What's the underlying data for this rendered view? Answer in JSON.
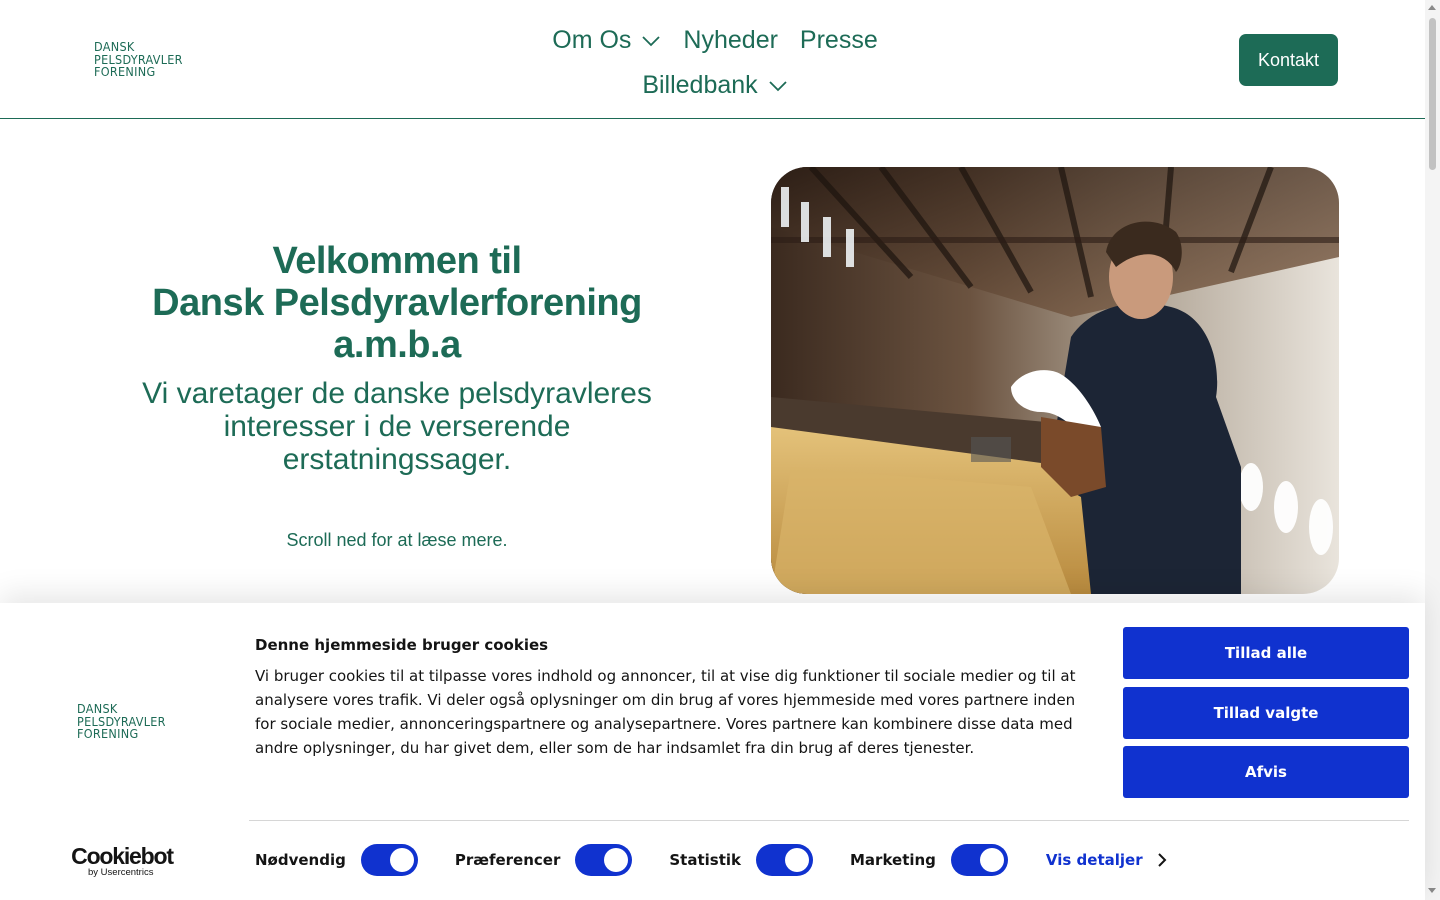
{
  "header": {
    "logo_lines": [
      "DANSK",
      "PELSDYRAVLER",
      "FORENING"
    ],
    "nav": [
      {
        "label": "Om Os",
        "has_dropdown": true
      },
      {
        "label": "Nyheder",
        "has_dropdown": false
      },
      {
        "label": "Presse",
        "has_dropdown": false
      },
      {
        "label": "Billedbank",
        "has_dropdown": true
      }
    ],
    "contact_button": "Kontakt"
  },
  "hero": {
    "title_lines": [
      "Velkommen til",
      "Dansk Pelsdyravlerforening",
      "a.m.b.a"
    ],
    "subtitle_lines": [
      "Vi varetager de danske pelsdyravleres",
      "interesser i de verserende",
      "erstatningssager."
    ],
    "scroll_hint": "Scroll ned for at læse mere."
  },
  "cookie_banner": {
    "logo_lines": [
      "DANSK",
      "PELSDYRAVLER",
      "FORENING"
    ],
    "title": "Denne hjemmeside bruger cookies",
    "body": "Vi bruger cookies til at tilpasse vores indhold og annoncer, til at vise dig funktioner til sociale medier og til at analysere vores trafik. Vi deler også oplysninger om din brug af vores hjemmeside med vores partnere inden for sociale medier, annonceringspartnere og analysepartnere. Vores partnere kan kombinere disse data med andre oplysninger, du har givet dem, eller som de har indsamlet fra din brug af deres tjenester.",
    "buttons": {
      "allow_all": "Tillad alle",
      "allow_selected": "Tillad valgte",
      "reject": "Afvis"
    },
    "consents": [
      {
        "label": "Nødvendig",
        "enabled": true
      },
      {
        "label": "Præferencer",
        "enabled": true
      },
      {
        "label": "Statistik",
        "enabled": true
      },
      {
        "label": "Marketing",
        "enabled": true
      }
    ],
    "details_link": "Vis detaljer",
    "cookiebot_brand": "Cookiebot",
    "cookiebot_by": "by Usercentrics"
  },
  "colors": {
    "brand_green": "#1d6b56",
    "cookie_blue": "#1032cf"
  }
}
